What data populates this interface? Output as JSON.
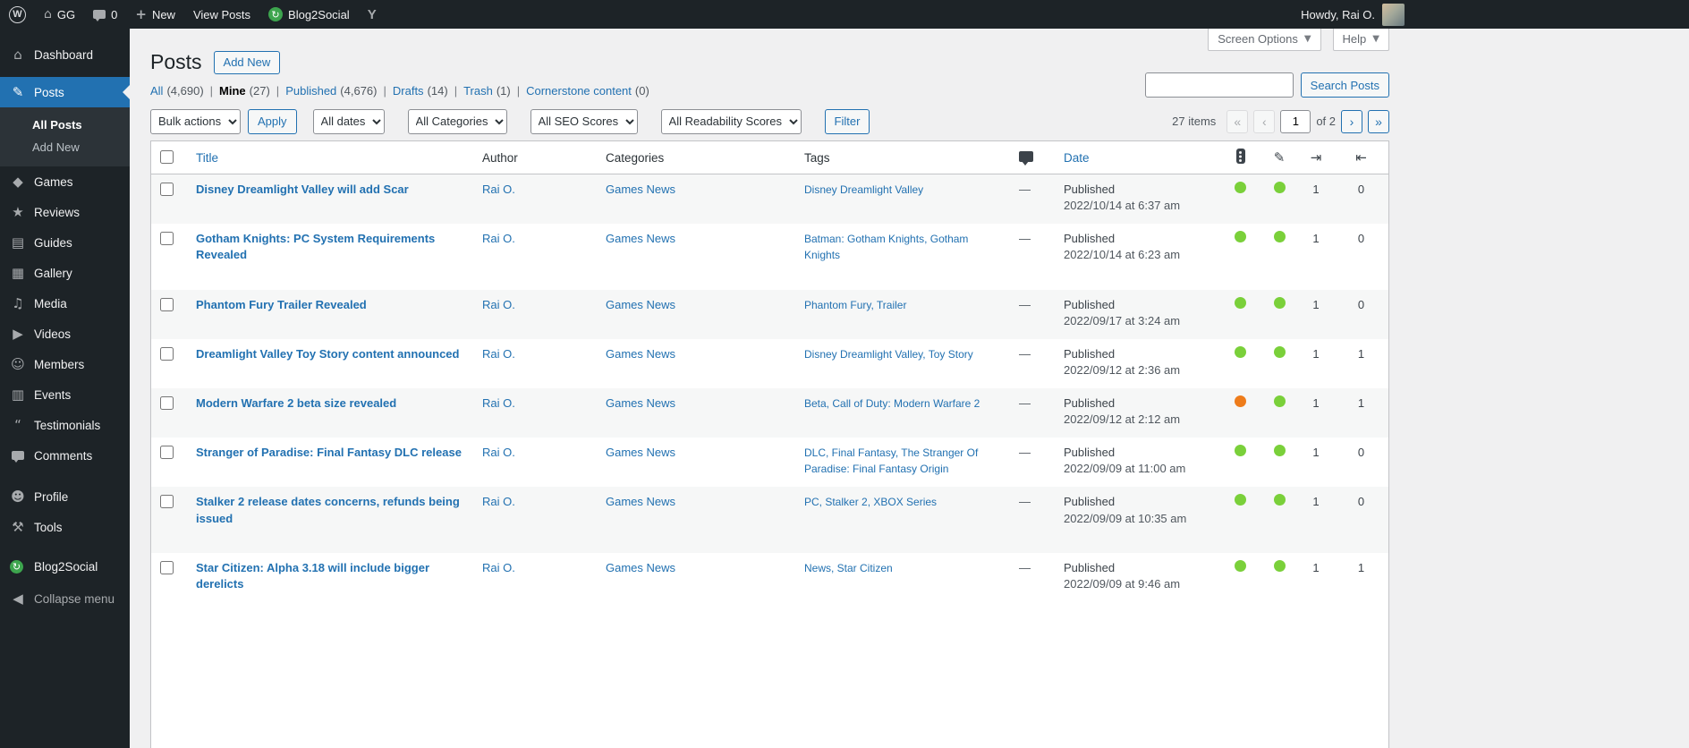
{
  "colors": {
    "accent": "#2271b1",
    "menu_bg": "#1d2327",
    "page_bg": "#f0f0f1",
    "seo_good": "#7ad03a",
    "seo_ok": "#ee7c1b"
  },
  "admin_bar": {
    "site_name": "GG",
    "comment_count": "0",
    "new_label": "New",
    "view_posts_label": "View Posts",
    "blog2social_label": "Blog2Social",
    "howdy": "Howdy, Rai O."
  },
  "sidebar": {
    "items": [
      {
        "label": "Dashboard",
        "glyph": "⌂"
      },
      {
        "label": "Posts",
        "glyph": "✎"
      },
      {
        "label": "All Posts"
      },
      {
        "label": "Add New"
      },
      {
        "label": "Games",
        "glyph": "◆"
      },
      {
        "label": "Reviews",
        "glyph": "★"
      },
      {
        "label": "Guides",
        "glyph": "▤"
      },
      {
        "label": "Gallery",
        "glyph": "▦"
      },
      {
        "label": "Media",
        "glyph": "♫"
      },
      {
        "label": "Videos",
        "glyph": "▶"
      },
      {
        "label": "Members",
        "glyph": "☺"
      },
      {
        "label": "Events",
        "glyph": "▥"
      },
      {
        "label": "Testimonials",
        "glyph": "“"
      },
      {
        "label": "Comments"
      },
      {
        "label": "Profile",
        "glyph": "☻"
      },
      {
        "label": "Tools",
        "glyph": "⚒"
      },
      {
        "label": "Blog2Social"
      },
      {
        "label": "Collapse menu",
        "glyph": "◀"
      }
    ]
  },
  "page": {
    "title": "Posts",
    "add_new": "Add New",
    "screen_options": "Screen Options",
    "help": "Help"
  },
  "views": [
    {
      "label": "All",
      "count": "(4,690)"
    },
    {
      "label": "Mine",
      "count": "(27)"
    },
    {
      "label": "Published",
      "count": "(4,676)"
    },
    {
      "label": "Drafts",
      "count": "(14)"
    },
    {
      "label": "Trash",
      "count": "(1)"
    },
    {
      "label": "Cornerstone content",
      "count": "(0)"
    }
  ],
  "search": {
    "value": "",
    "button_label": "Search Posts"
  },
  "filters": {
    "bulk_actions": "Bulk actions",
    "apply": "Apply",
    "all_dates": "All dates",
    "all_categories": "All Categories",
    "all_seo": "All SEO Scores",
    "all_readability": "All Readability Scores",
    "filter": "Filter"
  },
  "pagination": {
    "items": "27 items",
    "first": "«",
    "prev": "‹",
    "page": "1",
    "of": "of 2",
    "next": "›",
    "last": "»"
  },
  "table": {
    "headers": {
      "title": "Title",
      "author": "Author",
      "categories": "Categories",
      "tags": "Tags",
      "date": "Date"
    },
    "rows": [
      {
        "title": "Disney Dreamlight Valley will add Scar",
        "author": "Rai O.",
        "categories": "Games News",
        "tags": "Disney Dreamlight Valley",
        "comments": "—",
        "status": "Published",
        "date": "2022/10/14 at 6:37 am",
        "seo": "green",
        "readability": "green",
        "links": "1",
        "linked": "0"
      },
      {
        "title": "Gotham Knights: PC System Requirements Revealed",
        "author": "Rai O.",
        "categories": "Games News",
        "tags": "Batman: Gotham Knights, Gotham Knights",
        "comments": "—",
        "status": "Published",
        "date": "2022/10/14 at 6:23 am",
        "seo": "green",
        "readability": "green",
        "links": "1",
        "linked": "0"
      },
      {
        "title": "Phantom Fury Trailer Revealed",
        "author": "Rai O.",
        "categories": "Games News",
        "tags": "Phantom Fury, Trailer",
        "comments": "—",
        "status": "Published",
        "date": "2022/09/17 at 3:24 am",
        "seo": "green",
        "readability": "green",
        "links": "1",
        "linked": "0"
      },
      {
        "title": "Dreamlight Valley Toy Story content announced",
        "author": "Rai O.",
        "categories": "Games News",
        "tags": "Disney Dreamlight Valley, Toy Story",
        "comments": "—",
        "status": "Published",
        "date": "2022/09/12 at 2:36 am",
        "seo": "green",
        "readability": "green",
        "links": "1",
        "linked": "1"
      },
      {
        "title": "Modern Warfare 2 beta size revealed",
        "author": "Rai O.",
        "categories": "Games News",
        "tags": "Beta, Call of Duty: Modern Warfare 2",
        "comments": "—",
        "status": "Published",
        "date": "2022/09/12 at 2:12 am",
        "seo": "orange",
        "readability": "green",
        "links": "1",
        "linked": "1"
      },
      {
        "title": "Stranger of Paradise: Final Fantasy DLC release",
        "author": "Rai O.",
        "categories": "Games News",
        "tags": "DLC, Final Fantasy, The Stranger Of Paradise: Final Fantasy Origin",
        "comments": "—",
        "status": "Published",
        "date": "2022/09/09 at 11:00 am",
        "seo": "green",
        "readability": "green",
        "links": "1",
        "linked": "0"
      },
      {
        "title": "Stalker 2 release dates concerns, refunds being issued",
        "author": "Rai O.",
        "categories": "Games News",
        "tags": "PC, Stalker 2, XBOX Series",
        "comments": "—",
        "status": "Published",
        "date": "2022/09/09 at 10:35 am",
        "seo": "green",
        "readability": "green",
        "links": "1",
        "linked": "0"
      },
      {
        "title": "Star Citizen: Alpha 3.18 will include bigger derelicts",
        "author": "Rai O.",
        "categories": "Games News",
        "tags": "News, Star Citizen",
        "comments": "—",
        "status": "Published",
        "date": "2022/09/09 at 9:46 am",
        "seo": "green",
        "readability": "green",
        "links": "1",
        "linked": "1"
      }
    ]
  }
}
